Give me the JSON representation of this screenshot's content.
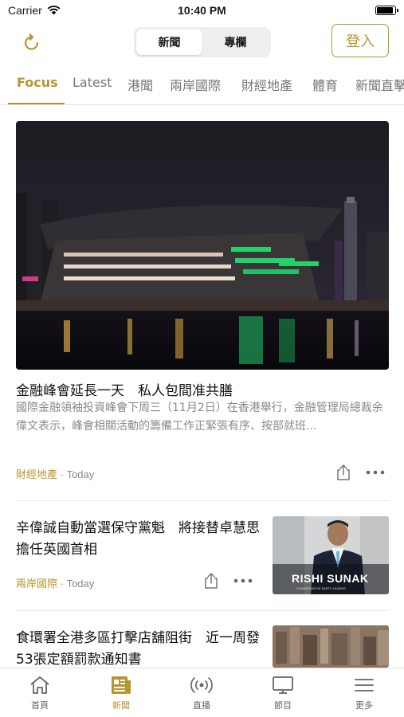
{
  "status": {
    "carrier": "Carrier",
    "time": "10:40 PM",
    "battery_level": 0.95
  },
  "header": {
    "segments": [
      "新聞",
      "專欄"
    ],
    "active_segment": 0,
    "login_label": "登入"
  },
  "tabs": [
    "Focus",
    "Latest",
    "港聞",
    "兩岸國際",
    "財經地產",
    "體育",
    "新聞直擊"
  ],
  "active_tab": 0,
  "articles": [
    {
      "title": "金融峰會延長一天　私人包間准共膳",
      "summary": "國際金融領袖投資峰會下周三（11月2日）在香港舉行，金融管理局總裁余偉文表示，峰會相關活動的籌備工作正緊張有序、按部就班...",
      "category": "財經地產",
      "time": "· Today"
    },
    {
      "title": "辛偉誠自動當選保守黨魁　將接替卓慧思擔任英國首相",
      "category": "兩岸國際",
      "time": "· Today",
      "thumb_caption": "RISHI SUNAK",
      "thumb_subcaption": "CONSERVATIVE PARTY LEADER"
    },
    {
      "title": "食環署全港多區打擊店舖阻街　近一周發53張定額罰款通知書"
    }
  ],
  "bottom_nav": [
    {
      "label": "首頁",
      "icon": "home-icon"
    },
    {
      "label": "新聞",
      "icon": "news-icon"
    },
    {
      "label": "直播",
      "icon": "live-broadcast-icon"
    },
    {
      "label": "節目",
      "icon": "tv-icon"
    },
    {
      "label": "更多",
      "icon": "menu-icon"
    }
  ],
  "active_nav": 1,
  "colors": {
    "accent": "#b8962e",
    "text": "#111111",
    "muted": "#8a8a8a"
  }
}
